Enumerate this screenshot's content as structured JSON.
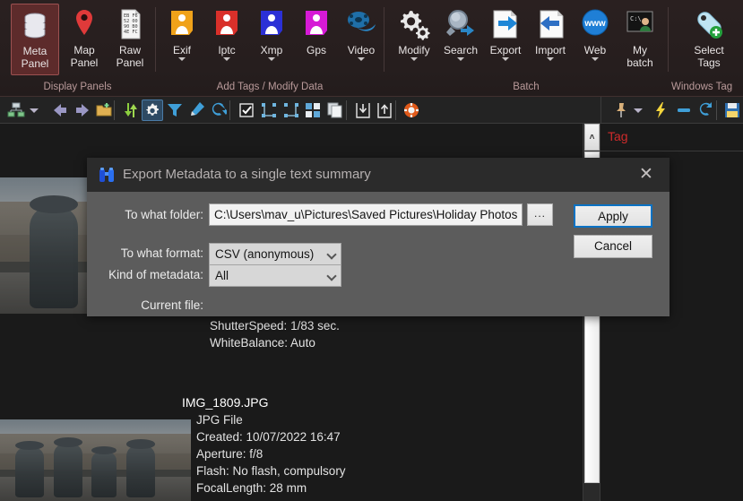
{
  "ribbon": {
    "groups": [
      {
        "label": "Display Panels"
      },
      {
        "label": "Add Tags / Modify Data"
      },
      {
        "label": "Batch"
      },
      {
        "label": "Windows Tag"
      }
    ],
    "buttons": [
      {
        "id": "meta-panel",
        "label": "Meta\nPanel",
        "line1": "Meta",
        "line2": "Panel",
        "icon": "database-icon",
        "selected": true,
        "caret": false
      },
      {
        "id": "map-panel",
        "label": "Map Panel",
        "line1": "Map",
        "line2": "Panel",
        "icon": "map-pin-icon",
        "selected": false,
        "caret": false
      },
      {
        "id": "raw-panel",
        "label": "Raw Panel",
        "line1": "Raw",
        "line2": "Panel",
        "icon": "raw-hex-icon",
        "selected": false,
        "caret": false
      },
      {
        "id": "exif",
        "label": "Exif",
        "line1": "Exif",
        "line2": "",
        "icon": "exif-person-icon",
        "selected": false,
        "caret": true
      },
      {
        "id": "iptc",
        "label": "Iptc",
        "line1": "Iptc",
        "line2": "",
        "icon": "iptc-person-icon",
        "selected": false,
        "caret": true
      },
      {
        "id": "xmp",
        "label": "Xmp",
        "line1": "Xmp",
        "line2": "",
        "icon": "xmp-person-icon",
        "selected": false,
        "caret": true
      },
      {
        "id": "gps",
        "label": "Gps",
        "line1": "Gps",
        "line2": "",
        "icon": "gps-person-icon",
        "selected": false,
        "caret": false
      },
      {
        "id": "video",
        "label": "Video",
        "line1": "Video",
        "line2": "",
        "icon": "film-reel-icon",
        "selected": false,
        "caret": true
      },
      {
        "id": "modify",
        "label": "Modify",
        "line1": "Modify",
        "line2": "",
        "icon": "gears-icon",
        "selected": false,
        "caret": true
      },
      {
        "id": "search",
        "label": "Search",
        "line1": "Search",
        "line2": "",
        "icon": "magnifier-icon",
        "selected": false,
        "caret": true
      },
      {
        "id": "export",
        "label": "Export",
        "line1": "Export",
        "line2": "",
        "icon": "export-page-icon",
        "selected": false,
        "caret": true
      },
      {
        "id": "import",
        "label": "Import",
        "line1": "Import",
        "line2": "",
        "icon": "import-page-icon",
        "selected": false,
        "caret": true
      },
      {
        "id": "web",
        "label": "Web",
        "line1": "Web",
        "line2": "",
        "icon": "www-globe-icon",
        "selected": false,
        "caret": true
      },
      {
        "id": "my-batch",
        "label": "My batch",
        "line1": "My",
        "line2": "batch",
        "icon": "console-icon",
        "selected": false,
        "caret": false
      },
      {
        "id": "select-tags",
        "label": "Select Tags",
        "line1": "Select",
        "line2": "Tags",
        "icon": "tag-plus-icon",
        "selected": false,
        "caret": false
      }
    ]
  },
  "toolbar": {
    "buttons": [
      {
        "id": "tree-add",
        "icon": "tree-add-icon",
        "active": false
      },
      {
        "id": "dropdown",
        "icon": "chevron-down-icon",
        "active": false
      },
      {
        "id": "back",
        "icon": "arrow-left-icon",
        "active": false
      },
      {
        "id": "forward",
        "icon": "arrow-right-icon",
        "active": false
      },
      {
        "id": "new-folder",
        "icon": "new-folder-icon",
        "active": false
      },
      {
        "id": "refresh-dir",
        "icon": "green-refresh-icon",
        "active": false
      },
      {
        "id": "settings",
        "icon": "gear-icon",
        "active": true
      },
      {
        "id": "filter",
        "icon": "funnel-icon",
        "active": false
      },
      {
        "id": "edit-pen",
        "icon": "pen-icon",
        "active": false
      },
      {
        "id": "sync",
        "icon": "sync-icon",
        "active": false
      },
      {
        "id": "select-all",
        "icon": "checkbox-icon",
        "active": false
      },
      {
        "id": "expand-tree",
        "icon": "expand-nodes-icon",
        "active": false
      },
      {
        "id": "collapse-tree",
        "icon": "collapse-nodes-icon",
        "active": false
      },
      {
        "id": "grid-view",
        "icon": "grid-view-icon",
        "active": false
      },
      {
        "id": "copy",
        "icon": "copy-icon",
        "active": false
      },
      {
        "id": "save-down",
        "icon": "save-down-icon",
        "active": false
      },
      {
        "id": "load-up",
        "icon": "load-up-icon",
        "active": false
      },
      {
        "id": "help",
        "icon": "lifering-icon",
        "active": false
      }
    ]
  },
  "tag_panel": {
    "title": "Tag",
    "buttons": [
      {
        "id": "pin",
        "icon": "pushpin-icon"
      },
      {
        "id": "pin-menu",
        "icon": "chevron-down-icon"
      },
      {
        "id": "quick",
        "icon": "lightning-icon"
      },
      {
        "id": "minus",
        "icon": "minus-bar-icon"
      },
      {
        "id": "refresh",
        "icon": "sync-icon"
      },
      {
        "id": "save",
        "icon": "floppy-save-icon"
      }
    ]
  },
  "scrollbar": {
    "up_arrow": "˄"
  },
  "files": [
    {
      "name": "",
      "lines": [
        "ShutterSpeed: 1/83 sec.",
        "WhiteBalance: Auto"
      ]
    },
    {
      "name": "IMG_1809.JPG",
      "lines": [
        "JPG File",
        "Created: 10/07/2022 16:47",
        "Aperture: f/8",
        "Flash: No flash, compulsory",
        "FocalLength: 28 mm"
      ]
    }
  ],
  "dialog": {
    "title": "Export Metadata to a single text summary",
    "icon": "binoculars-icon",
    "close_label": "✕",
    "fields": {
      "folder_label": "To what folder:",
      "folder_value": "C:\\Users\\mav_u\\Pictures\\Saved Pictures\\Holiday Photos",
      "browse_label": "...",
      "format_label": "To what format:",
      "format_value": "CSV (anonymous)",
      "metadata_label": "Kind of metadata:",
      "metadata_value": "All",
      "current_file_label": "Current file:",
      "current_file_value": ""
    },
    "buttons": {
      "apply": "Apply",
      "cancel": "Cancel"
    }
  },
  "colors": {
    "ribbon_bg": "#2a2020",
    "selected_tile": "#5d2b2b",
    "group_label": "#b99a9a",
    "dialog_bg": "#5c5c5c",
    "dialog_title_bg": "#2b2b2b",
    "accent_blue": "#0a72c4",
    "tag_red": "#d02b2b",
    "content_bg": "#1a1a1a"
  }
}
